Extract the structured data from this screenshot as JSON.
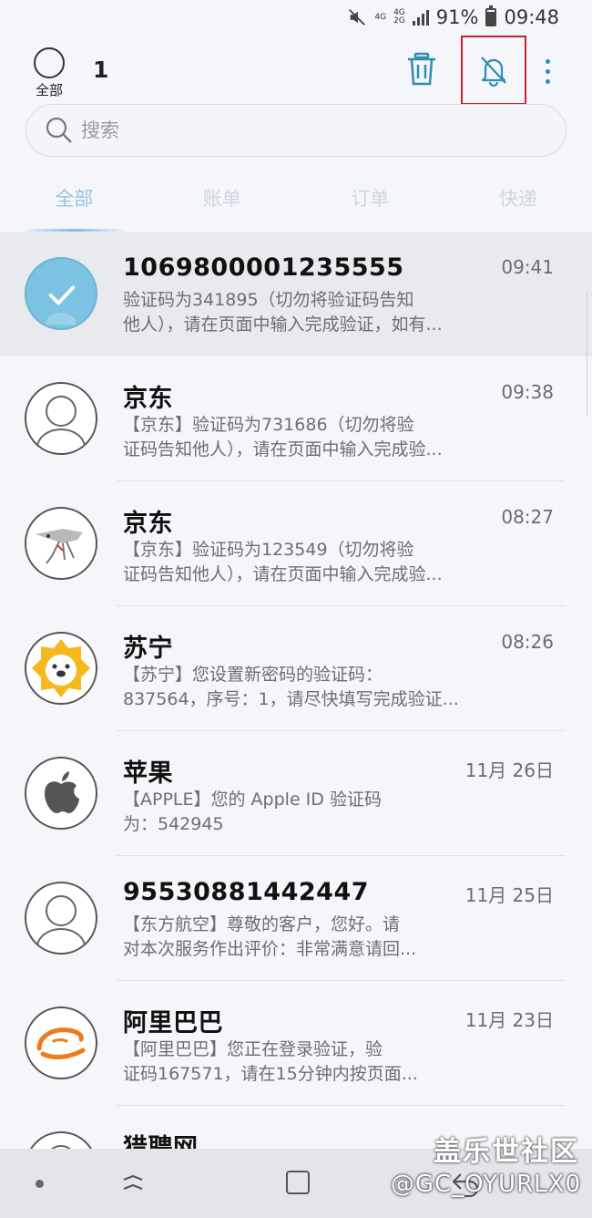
{
  "status_bar": {
    "network_top": "4G",
    "network_bottom": "4G",
    "network_sub": "2G",
    "battery": "91%",
    "time": "09:48"
  },
  "header": {
    "select_all_label": "全部",
    "selected_count": "1"
  },
  "search": {
    "placeholder": "搜索"
  },
  "tabs": [
    {
      "label": "全部",
      "active": true
    },
    {
      "label": "账单",
      "active": false
    },
    {
      "label": "订单",
      "active": false
    },
    {
      "label": "快递",
      "active": false
    }
  ],
  "messages": [
    {
      "sender": "1069800001235555",
      "time": "09:41",
      "line1": "验证码为341895（切勿将验证码告知",
      "line2": "他人），请在页面中输入完成验证，如有...",
      "avatar": "checked"
    },
    {
      "sender": "京东",
      "time": "09:38",
      "line1": "【京东】验证码为731686（切勿将验",
      "line2": "证码告知他人），请在页面中输入完成验...",
      "avatar": "person"
    },
    {
      "sender": "京东",
      "time": "08:27",
      "line1": "【京东】验证码为123549（切勿将验",
      "line2": "证码告知他人），请在页面中输入完成验...",
      "avatar": "jd-dog"
    },
    {
      "sender": "苏宁",
      "time": "08:26",
      "line1": "【苏宁】您设置新密码的验证码：",
      "line2": "837564，序号：1，请尽快填写完成验证...",
      "avatar": "suning-lion"
    },
    {
      "sender": "苹果",
      "time": "11月 26日",
      "line1": "【APPLE】您的 Apple ID 验证码",
      "line2": "为：542945",
      "avatar": "apple"
    },
    {
      "sender": "95530881442447",
      "time": "11月 25日",
      "line1": "【东方航空】尊敬的客户，您好。请",
      "line2": "对本次服务作出评价：非常满意请回...",
      "avatar": "person"
    },
    {
      "sender": "阿里巴巴",
      "time": "11月 23日",
      "line1": "【阿里巴巴】您正在登录验证，验",
      "line2": "证码167571，请在15分钟内按页面...",
      "avatar": "alibaba"
    },
    {
      "sender": "猎聘网",
      "time": "",
      "line1": "",
      "line2": "",
      "avatar": "person"
    }
  ],
  "watermark": {
    "line1": "盖乐世社区",
    "line2": "@GC_OYURLX0"
  },
  "colors": {
    "accent": "#2a8fb1",
    "highlight_border": "#c8232c",
    "selected_row": "#e9eaee"
  }
}
